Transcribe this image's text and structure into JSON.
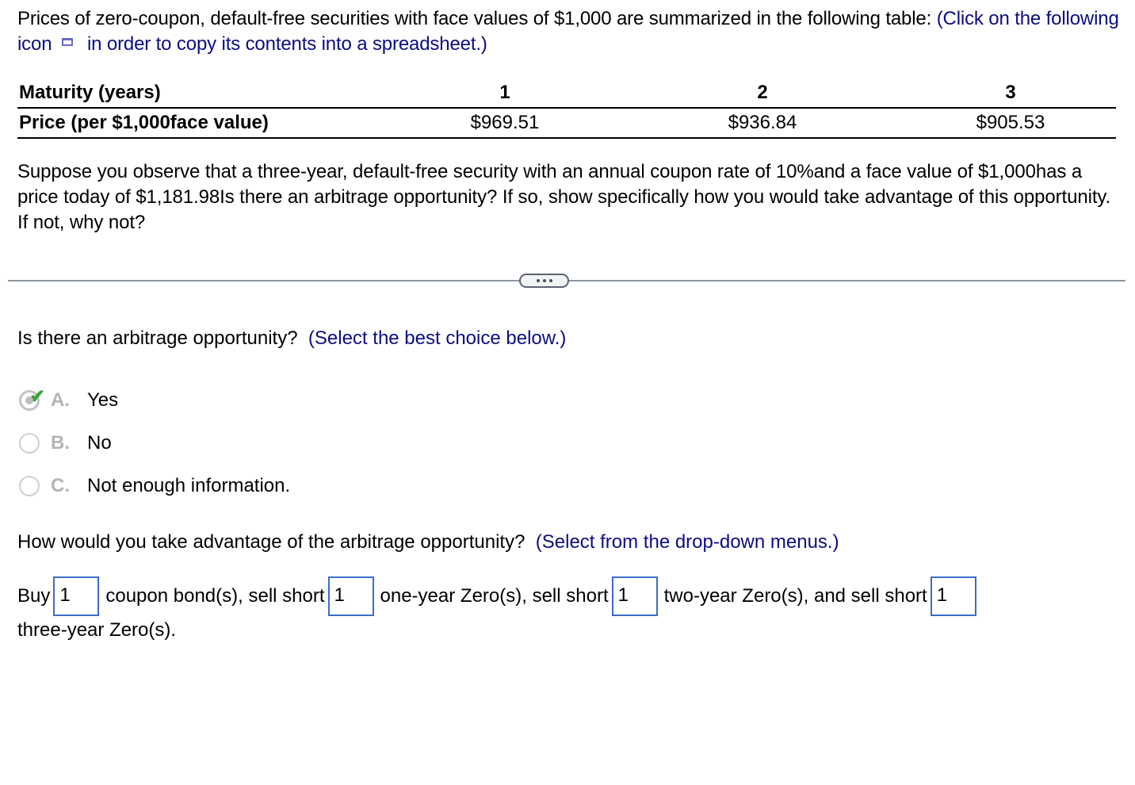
{
  "intro": {
    "text": "Prices of zero-coupon, default-free securities with face values of $1,000 are summarized in the following table:",
    "instruction_before_icon": "(Click on the following icon",
    "copy_icon": "copy-to-spreadsheet-icon",
    "instruction_after_icon": "in order to copy its contents into a spreadsheet.)"
  },
  "table": {
    "row_headers": [
      "Maturity (years)",
      "Price (per $1,000face value)"
    ],
    "maturities": [
      "1",
      "2",
      "3"
    ],
    "prices": [
      "$969.51",
      "$936.84",
      "$905.53"
    ]
  },
  "question": {
    "text": "Suppose you observe that a three-year, default-free security with an annual coupon rate of 10%and a face value of $1,000has a price today of $1,181.98Is there an arbitrage opportunity? If so, show specifically how you would take advantage of this opportunity. If not, why not?"
  },
  "divider": {
    "more_button_icon": "ellipsis-icon"
  },
  "part1": {
    "prompt": "Is there an arbitrage opportunity?",
    "instruction": "(Select the best choice below.)",
    "choices": [
      {
        "letter": "A.",
        "label": "Yes",
        "selected": true,
        "correct": true
      },
      {
        "letter": "B.",
        "label": "No",
        "selected": false
      },
      {
        "letter": "C.",
        "label": "Not enough information.",
        "selected": false
      }
    ]
  },
  "part2": {
    "prompt": "How would you take advantage of the arbitrage opportunity?",
    "instruction": "(Select from the drop-down menus.)",
    "segments": {
      "buy": "Buy",
      "coupon": "coupon bond(s), sell short",
      "one_year": "one-year Zero(s), sell short",
      "two_year": "two-year Zero(s), and sell short",
      "three_year": "three-year Zero(s)."
    },
    "dropdowns": {
      "coupon_bonds": "1",
      "one_year_zeros": "1",
      "two_year_zeros": "1",
      "three_year_zeros": "1"
    }
  },
  "colors": {
    "instruction_blue": "#0d0d80",
    "dropdown_border": "#3c6ccc",
    "check_green": "#3aa03a"
  }
}
